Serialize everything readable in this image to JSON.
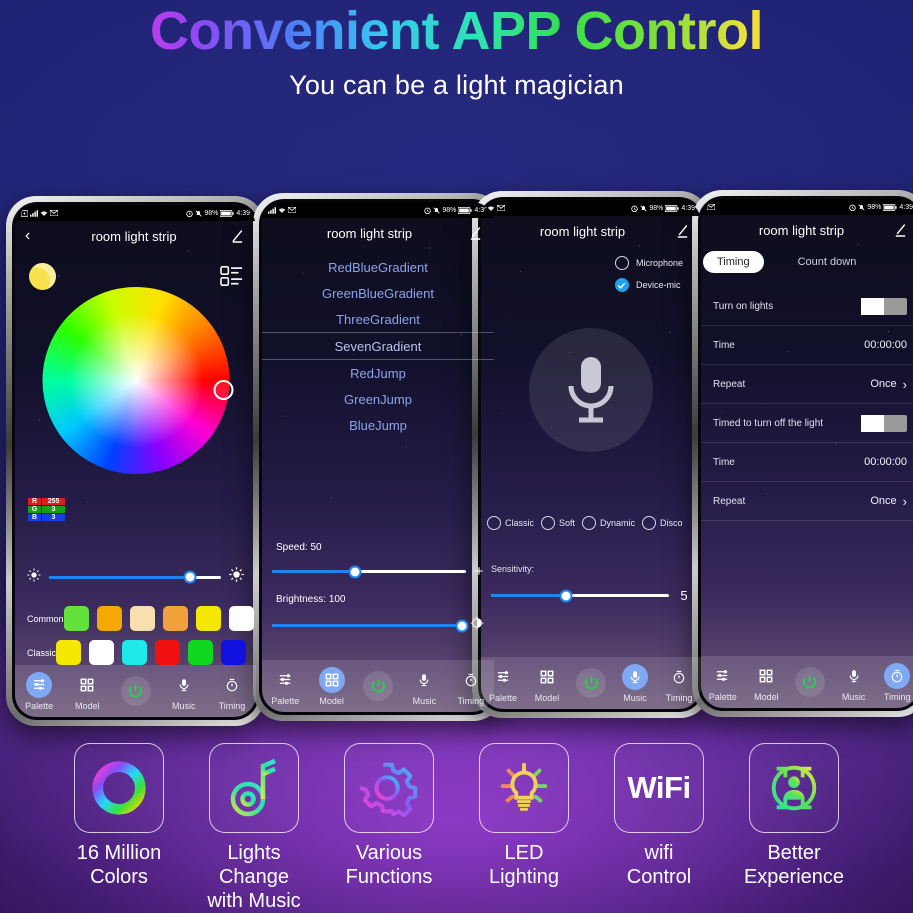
{
  "hero": {
    "headline": "Convenient APP Control",
    "subhead": "You can be a light magician"
  },
  "statusbar": {
    "battery": "98%",
    "time": "4:39"
  },
  "app": {
    "title": "room light strip",
    "edit_icon": "pencil-icon",
    "back_icon": "chevron-left-icon"
  },
  "nav": {
    "palette": "Palette",
    "model": "Model",
    "power": "power-icon",
    "music": "Music",
    "timing": "Timing"
  },
  "phone1": {
    "rgb": {
      "r_key": "R",
      "r_val": "255",
      "g_key": "G",
      "g_val": "3",
      "b_key": "B",
      "b_val": "3"
    },
    "brightness_percent": 82,
    "swatch_rows": [
      {
        "label": "Common",
        "colors": [
          "#64e23c",
          "#f5a800",
          "#f7dfb0",
          "#f2a03a",
          "#f5e800",
          "#ffffff"
        ]
      },
      {
        "label": "Classic",
        "colors": [
          "#f5e800",
          "#ffffff",
          "#1ee8e8",
          "#f01010",
          "#10d820",
          "#1010e0"
        ]
      }
    ]
  },
  "phone2": {
    "modes": [
      "RedBlueGradient",
      "GreenBlueGradient",
      "ThreeGradient",
      "SevenGradient",
      "RedJump",
      "GreenJump",
      "BlueJump"
    ],
    "selected_mode": "SevenGradient",
    "speed_label": "Speed:",
    "speed_value": "50",
    "speed_percent": 43,
    "brightness_label": "Brightness:",
    "brightness_value": "100",
    "brightness_percent": 100,
    "plus_label": "+"
  },
  "phone3": {
    "source_options": [
      {
        "label": "Microphone",
        "selected": false
      },
      {
        "label": "Device-mic",
        "selected": true
      }
    ],
    "mic_icon": "microphone-icon",
    "music_modes": [
      {
        "label": "Classic",
        "selected": false
      },
      {
        "label": "Soft",
        "selected": false
      },
      {
        "label": "Dynamic",
        "selected": false
      },
      {
        "label": "Disco",
        "selected": false
      }
    ],
    "sensitivity_label": "Sensitivity:",
    "sensitivity_value": "5",
    "sensitivity_percent": 42
  },
  "phone4": {
    "tabs": [
      {
        "label": "Timing",
        "active": true
      },
      {
        "label": "Count down",
        "active": false
      }
    ],
    "rows": [
      {
        "label": "Turn on lights",
        "value": "",
        "toggle": true
      },
      {
        "label": "Time",
        "value": "00:00:00",
        "toggle": false
      },
      {
        "label": "Repeat",
        "value": "Once",
        "chevron": true
      },
      {
        "label": "Timed to turn off the light",
        "value": "",
        "toggle": true
      },
      {
        "label": "Time",
        "value": "00:00:00",
        "toggle": false
      },
      {
        "label": "Repeat",
        "value": "Once",
        "chevron": true
      }
    ]
  },
  "features": [
    {
      "icon": "color-wheel-icon",
      "line1": "16 Million",
      "line2": "Colors"
    },
    {
      "icon": "music-note-icon",
      "line1": "Lights Change",
      "line2": "with Music"
    },
    {
      "icon": "gear-icon",
      "line1": "Various",
      "line2": "Functions"
    },
    {
      "icon": "lightbulb-icon",
      "line1": "LED",
      "line2": "Lighting"
    },
    {
      "icon": "wifi-text-icon",
      "line1": "wifi",
      "line2": "Control",
      "text": "WiFi"
    },
    {
      "icon": "user-target-icon",
      "line1": "Better",
      "line2": "Experience"
    }
  ],
  "colors": {
    "accent_blue": "#1d84f0",
    "nav_active": "#7fa9f2",
    "power_green": "#22d649"
  }
}
